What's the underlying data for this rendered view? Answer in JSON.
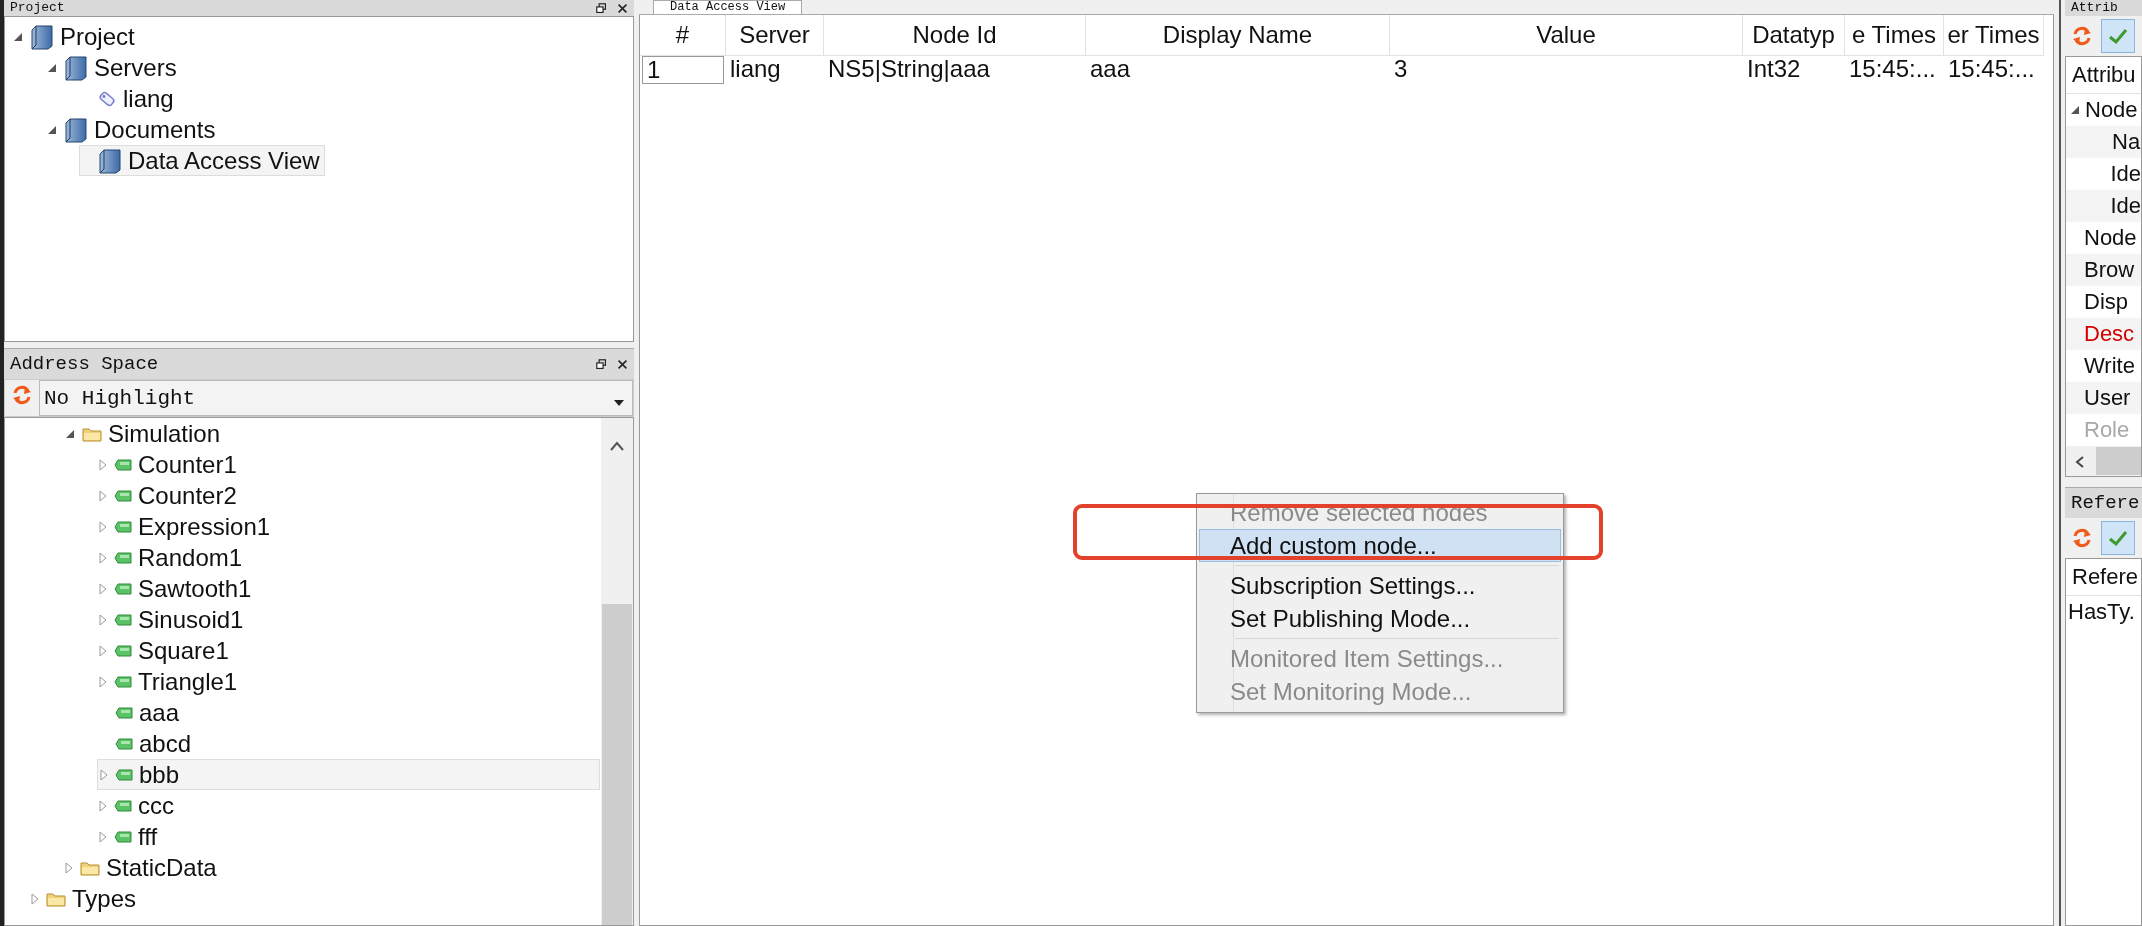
{
  "project_panel": {
    "title": "Project",
    "tree": [
      {
        "label": "Project",
        "kind": "book",
        "expandable": true,
        "expanded": true,
        "selected": false,
        "children": [
          {
            "label": "Servers",
            "kind": "book",
            "expandable": true,
            "expanded": true,
            "selected": false,
            "children": [
              {
                "label": "liang",
                "kind": "server",
                "expandable": false,
                "selected": false
              }
            ]
          },
          {
            "label": "Documents",
            "kind": "book",
            "expandable": true,
            "expanded": true,
            "selected": false,
            "children": [
              {
                "label": "Data Access View",
                "kind": "book",
                "expandable": false,
                "selected": true
              }
            ]
          }
        ]
      }
    ]
  },
  "address_panel": {
    "title": "Address Space",
    "highlight_select": {
      "value": "No Highlight"
    },
    "tree": [
      {
        "children": [
          {
            "label": "Simulation",
            "kind": "folder",
            "expandable": true,
            "expanded": true,
            "selected": false,
            "children": [
              {
                "label": "Counter1",
                "kind": "variable",
                "expandable": true,
                "expanded": false,
                "selected": false
              },
              {
                "label": "Counter2",
                "kind": "variable",
                "expandable": true,
                "expanded": false,
                "selected": false
              },
              {
                "label": "Expression1",
                "kind": "variable",
                "expandable": true,
                "expanded": false,
                "selected": false
              },
              {
                "label": "Random1",
                "kind": "variable",
                "expandable": true,
                "expanded": false,
                "selected": false
              },
              {
                "label": "Sawtooth1",
                "kind": "variable",
                "expandable": true,
                "expanded": false,
                "selected": false
              },
              {
                "label": "Sinusoid1",
                "kind": "variable",
                "expandable": true,
                "expanded": false,
                "selected": false
              },
              {
                "label": "Square1",
                "kind": "variable",
                "expandable": true,
                "expanded": false,
                "selected": false
              },
              {
                "label": "Triangle1",
                "kind": "variable",
                "expandable": true,
                "expanded": false,
                "selected": false
              },
              {
                "label": "aaa",
                "kind": "variable",
                "expandable": false,
                "selected": false
              },
              {
                "label": "abcd",
                "kind": "variable",
                "expandable": false,
                "selected": false
              },
              {
                "label": "bbb",
                "kind": "variable",
                "expandable": true,
                "expanded": false,
                "selected": true
              },
              {
                "label": "ccc",
                "kind": "variable",
                "expandable": true,
                "expanded": false,
                "selected": false
              },
              {
                "label": "fff",
                "kind": "variable",
                "expandable": true,
                "expanded": false,
                "selected": false
              }
            ]
          },
          {
            "label": "StaticData",
            "kind": "folder",
            "expandable": true,
            "expanded": false,
            "selected": false
          }
        ]
      },
      {
        "label": "Types",
        "kind": "folder",
        "expandable": true,
        "expanded": false,
        "selected": false
      }
    ]
  },
  "data_view": {
    "tab": "Data Access View",
    "table": {
      "columns": [
        "#",
        "Server",
        "Node Id",
        "Display Name",
        "Value",
        "Datatyp",
        "e Times",
        "er Times"
      ],
      "rows": [
        [
          "1",
          "liang",
          "NS5|String|aaa",
          "aaa",
          "3",
          "Int32",
          "15:45:...",
          "15:45:..."
        ]
      ]
    }
  },
  "context_menu": {
    "items": [
      {
        "label": "Remove selected nodes",
        "disabled": true,
        "selected": false,
        "annotated": false
      },
      {
        "label": "Add custom node...",
        "disabled": false,
        "selected": true,
        "annotated": true
      },
      {
        "kind": "separator"
      },
      {
        "label": "Subscription Settings...",
        "disabled": false,
        "selected": false,
        "annotated": false
      },
      {
        "label": "Set Publishing Mode...",
        "disabled": false,
        "selected": false,
        "annotated": false
      },
      {
        "kind": "separator"
      },
      {
        "label": "Monitored Item Settings...",
        "disabled": true,
        "selected": false,
        "annotated": false
      },
      {
        "label": "Set Monitoring Mode...",
        "disabled": true,
        "selected": false,
        "annotated": false
      }
    ]
  },
  "attributes_panel": {
    "title": "Attrib",
    "column": "Attribu",
    "rows": [
      {
        "label": "Node",
        "color": "#111111",
        "expandable": true,
        "expanded": true,
        "children": [
          {
            "label": "Na",
            "color": "#111111",
            "expandable": false
          },
          {
            "label": "Ide",
            "color": "#111111",
            "expandable": false
          },
          {
            "label": "Ide",
            "color": "#111111",
            "expandable": false
          }
        ]
      },
      {
        "label": "Node",
        "color": "#111111",
        "expandable": false
      },
      {
        "label": "Brow",
        "color": "#111111",
        "expandable": false
      },
      {
        "label": "Disp",
        "color": "#111111",
        "expandable": false
      },
      {
        "label": "Desc",
        "color": "#d40000",
        "expandable": false
      },
      {
        "label": "Write",
        "color": "#111111",
        "expandable": false
      },
      {
        "label": "User",
        "color": "#111111",
        "expandable": false
      },
      {
        "label": "Role",
        "color": "#a8a8a8",
        "expandable": false
      }
    ]
  },
  "references_panel": {
    "title": "Refere",
    "column": "Refere",
    "rows": [
      "HasTy."
    ]
  }
}
